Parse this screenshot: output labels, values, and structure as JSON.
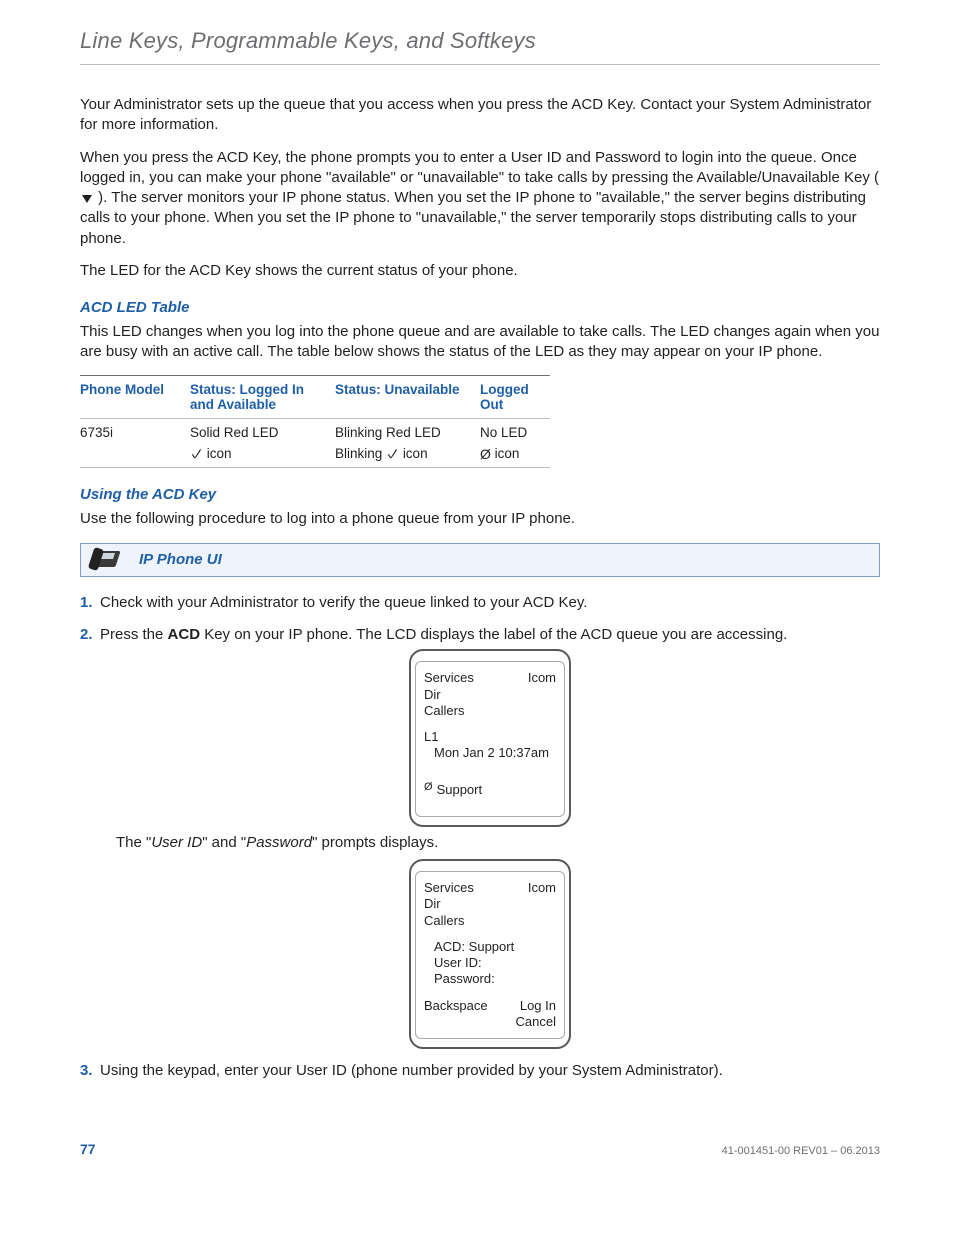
{
  "header": {
    "title": "Line Keys, Programmable Keys, and Softkeys"
  },
  "paragraphs": {
    "p1": "Your Administrator sets up the queue that you access when you press the ACD Key. Contact your System Administrator for more information.",
    "p2a": "When you press the ACD Key, the phone prompts you to enter a User ID and Password to login into the queue. Once logged in, you can make your phone \"available\" or \"unavailable\" to take calls by pressing the Available/Unavailable Key (",
    "p2b": "). The server monitors your IP phone status. When you set the IP phone to \"available,\" the server begins distributing calls to your phone. When you set the IP phone to \"unavailable,\" the server temporarily stops distributing calls to your phone.",
    "p3": "The LED for the ACD Key shows the current status of your phone.",
    "acd_intro": "This LED changes when you log into the phone queue and are available to take calls. The LED changes again when you are busy with an active call. The table below shows the status of the LED as they may appear on your IP phone.",
    "use_intro": "Use the following procedure to log into a phone queue from your IP phone.",
    "after_lcd1_a": "The \"",
    "after_lcd1_b": "\" and \"",
    "after_lcd1_c": "\" prompts displays."
  },
  "terms": {
    "user_id": "User ID",
    "password": "Password"
  },
  "headings": {
    "acd_led_table": "ACD LED Table",
    "using_acd": "Using the ACD Key"
  },
  "callout": {
    "label": "IP Phone UI"
  },
  "table": {
    "headers": {
      "model": "Phone Model",
      "available": "Status: Logged In and Available",
      "unavailable": "Status: Unavailable",
      "logged_out": "Logged Out"
    },
    "row": {
      "model": "6735i",
      "available_led": "Solid Red LED",
      "available_icon_text": "icon",
      "unavailable_led": "Blinking Red LED",
      "unavailable_prefix": "Blinking",
      "unavailable_icon_text": "icon",
      "out_led": "No LED",
      "out_icon_text": "icon"
    }
  },
  "steps": {
    "s1": "Check with your Administrator to verify the queue linked to your ACD Key.",
    "s2a": "Press the ",
    "s2b": "ACD",
    "s2c": " Key on your IP phone. The LCD displays the label of the ACD queue you are accessing.",
    "s3": "Using the keypad, enter your User ID (phone number provided by your System Administrator)."
  },
  "lcd1": {
    "services": "Services",
    "icom": "Icom",
    "dir": "Dir",
    "callers": "Callers",
    "l1": "L1",
    "datetime": "Mon Jan 2 10:37am",
    "support": "Support"
  },
  "lcd2": {
    "services": "Services",
    "icom": "Icom",
    "dir": "Dir",
    "callers": "Callers",
    "acd": "ACD: Support",
    "user": "User ID:",
    "pass": "Password:",
    "backspace": "Backspace",
    "login": "Log In",
    "cancel": "Cancel"
  },
  "footer": {
    "page": "77",
    "docid": "41-001451-00 REV01 – 06.2013"
  }
}
